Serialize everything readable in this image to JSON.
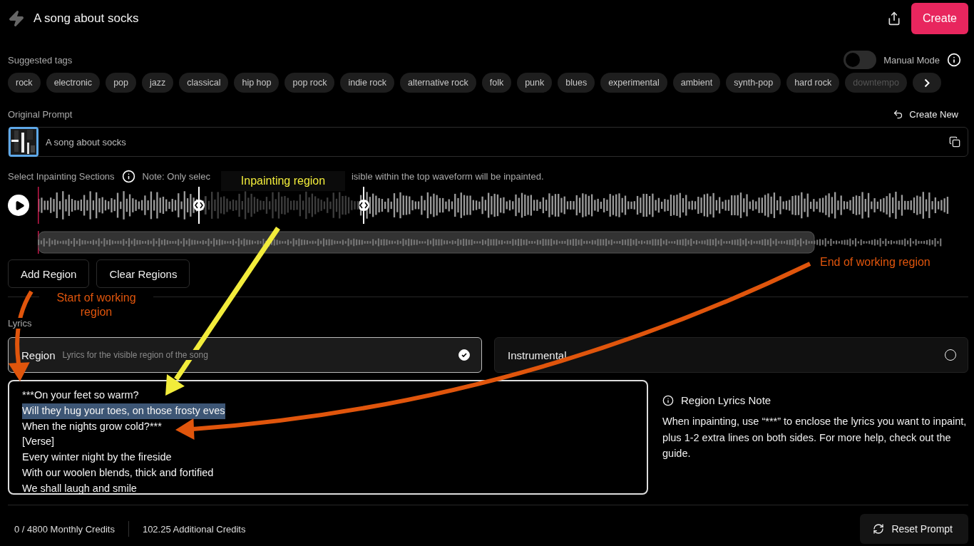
{
  "header": {
    "title": "A song about socks",
    "create_label": "Create"
  },
  "manual_mode": {
    "label": "Manual Mode",
    "on": false
  },
  "tags": {
    "label": "Suggested tags",
    "items": [
      "rock",
      "electronic",
      "pop",
      "jazz",
      "classical",
      "hip hop",
      "pop rock",
      "indie rock",
      "alternative rock",
      "folk",
      "punk",
      "blues",
      "experimental",
      "ambient",
      "synth-pop",
      "hard rock",
      "downtempo"
    ]
  },
  "original_prompt": {
    "label": "Original Prompt",
    "create_new": "Create New",
    "value": "A song about socks"
  },
  "inpainting": {
    "label": "Select Inpainting Sections",
    "note_start": "Note: Only selec",
    "note_end": "isible within the top waveform will be inpainted.",
    "buttons": [
      "Add Region",
      "Clear Regions"
    ]
  },
  "lyrics": {
    "label": "Lyrics",
    "options": [
      {
        "title": "Region",
        "subtitle": "Lyrics for the visible region of the song",
        "selected": true
      },
      {
        "title": "Instrumental",
        "selected": false
      }
    ],
    "lines": [
      {
        "text": "***On your feet so warm?",
        "selected": false
      },
      {
        "text": "Will they hug your toes, on those frosty eves",
        "selected": true
      },
      {
        "text": "When the nights grow cold?***",
        "selected": false
      },
      {
        "text": "[Verse]",
        "selected": false
      },
      {
        "text": "Every winter night by the fireside",
        "selected": false
      },
      {
        "text": "With our woolen blends, thick and fortified",
        "selected": false
      },
      {
        "text": "We shall laugh and smile",
        "selected": false
      }
    ],
    "note": {
      "title": "Region Lyrics Note",
      "body": "When inpainting, use “***” to enclose the lyrics you want to inpaint, plus 1-2 extra lines on both sides. For more help, check out the guide."
    }
  },
  "footer": {
    "monthly": "0 / 4800 Monthly Credits",
    "additional": "102.25 Additional Credits",
    "reset": "Reset Prompt"
  },
  "annotations": [
    {
      "text": "Inpainting region",
      "color": "#f2ec3b"
    },
    {
      "text": "Start of working region",
      "color": "#e0550c"
    },
    {
      "text": "End of working region",
      "color": "#e0550c"
    }
  ]
}
